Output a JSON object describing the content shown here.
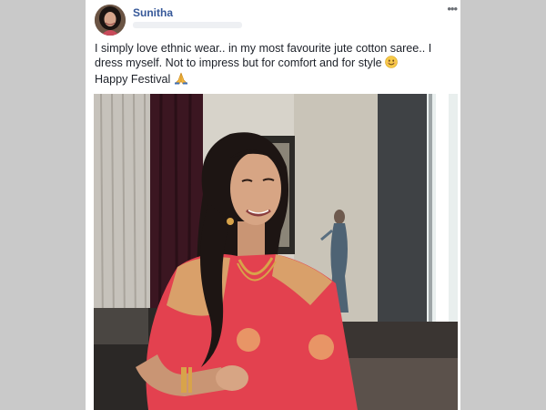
{
  "post": {
    "author_name": "Sunitha",
    "menu_icon": "more-options-icon",
    "text_line_1": "I simply love ethnic wear.. in my most favourite jute cotton saree.. I dress myself. Not to impress but for comfort and for style",
    "emoji_1": "smiling-face-emoji",
    "text_line_2": "Happy Festival",
    "emoji_2": "folded-hands-emoji"
  },
  "colors": {
    "author_link": "#365899",
    "text": "#1d2129",
    "saree": "#e3414f",
    "border_gold": "#d9a06a",
    "background": "#c9c9c9"
  }
}
